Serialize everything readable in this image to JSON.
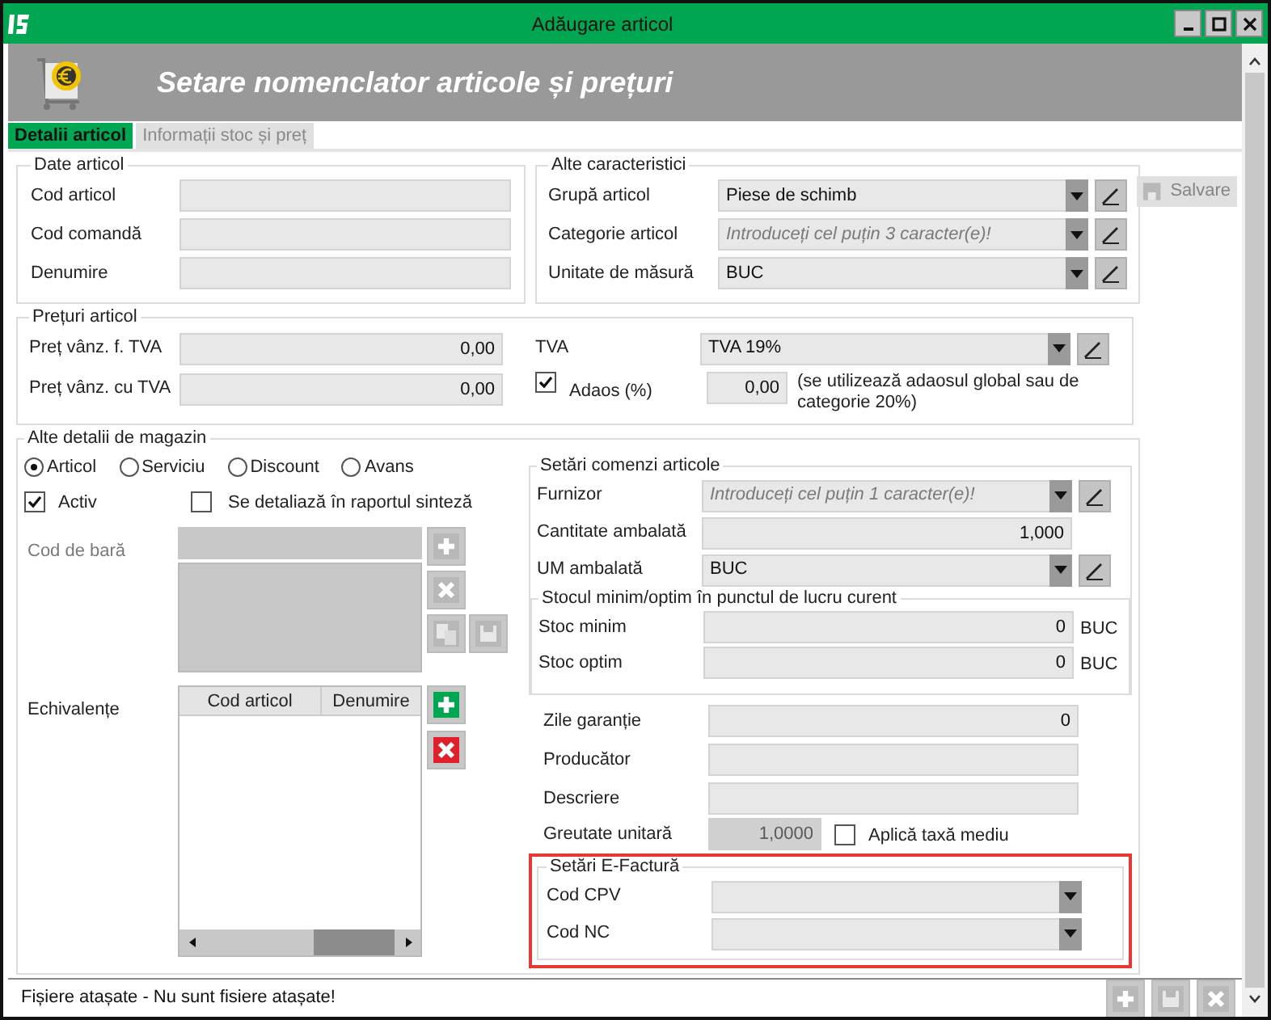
{
  "window": {
    "title": "Adăugare articol"
  },
  "header": {
    "title": "Setare nomenclator articole și prețuri"
  },
  "tabs": [
    {
      "label": "Detalii articol",
      "selected": true
    },
    {
      "label": "Informații stoc și preț",
      "selected": false
    }
  ],
  "save_button": {
    "label": "Salvare",
    "disabled": true
  },
  "date_articol": {
    "legend": "Date articol",
    "fields": [
      {
        "label": "Cod articol"
      },
      {
        "label": "Cod comandă"
      },
      {
        "label": "Denumire"
      }
    ]
  },
  "alte_caracteristici": {
    "legend": "Alte caracteristici",
    "fields": [
      {
        "label": "Grupă articol",
        "value": "Piese de schimb"
      },
      {
        "label": "Categorie articol",
        "placeholder": "Introduceți cel puțin 3 caracter(e)!"
      },
      {
        "label": "Unitate de măsură",
        "value": "BUC"
      }
    ]
  },
  "preturi": {
    "legend": "Prețuri articol",
    "fields": [
      {
        "label": "Preț vânz. f. TVA",
        "value": "0,00"
      },
      {
        "label": "Preț vânz. cu TVA",
        "value": "0,00"
      }
    ],
    "tva": {
      "label": "TVA",
      "value": "TVA 19%"
    },
    "adaos": {
      "label": "Adaos (%)",
      "checked": true,
      "value": "0,00",
      "note": "(se utilizează adaosul global sau de categorie 20%)"
    }
  },
  "magazin": {
    "legend": "Alte detalii de magazin",
    "types": [
      {
        "label": "Articol",
        "selected": true
      },
      {
        "label": "Serviciu",
        "selected": false
      },
      {
        "label": "Discount",
        "selected": false
      },
      {
        "label": "Avans",
        "selected": false
      }
    ],
    "activ": {
      "label": "Activ",
      "checked": true
    },
    "sinteza": {
      "label": "Se detaliază în raportul sinteză",
      "checked": false
    },
    "barcode": {
      "label": "Cod de bară"
    },
    "echivalente": {
      "label": "Echivalențe",
      "columns": [
        "Cod articol",
        "Denumire"
      ]
    }
  },
  "comenzi": {
    "legend": "Setări comenzi articole",
    "fields": [
      {
        "kind": "combo",
        "label": "Furnizor",
        "placeholder": "Introduceți cel puțin 1 caracter(e)!"
      },
      {
        "kind": "text",
        "label": "Cantitate ambalată",
        "value": "1,000"
      },
      {
        "kind": "combo",
        "label": "UM ambalată",
        "value": "BUC"
      }
    ]
  },
  "stoc": {
    "legend": "Stocul minim/optim în punctul de lucru curent",
    "fields": [
      {
        "label": "Stoc minim",
        "value": "0",
        "unit": "BUC"
      },
      {
        "label": "Stoc optim",
        "value": "0",
        "unit": "BUC"
      }
    ]
  },
  "extra_fields": [
    {
      "label": "Zile garanție",
      "value": "0"
    },
    {
      "label": "Producător"
    },
    {
      "label": "Descriere"
    }
  ],
  "greutate": {
    "label": "Greutate unitară",
    "value": "1,0000"
  },
  "taxa_mediu": {
    "label": "Aplică taxă mediu",
    "checked": false
  },
  "efactura": {
    "legend": "Setări E-Factură",
    "highlighted": true,
    "fields": [
      {
        "label": "Cod CPV"
      },
      {
        "label": "Cod NC"
      }
    ]
  },
  "status_bar": {
    "text": "Fișiere atașate - Nu sunt fisiere atașate!"
  }
}
